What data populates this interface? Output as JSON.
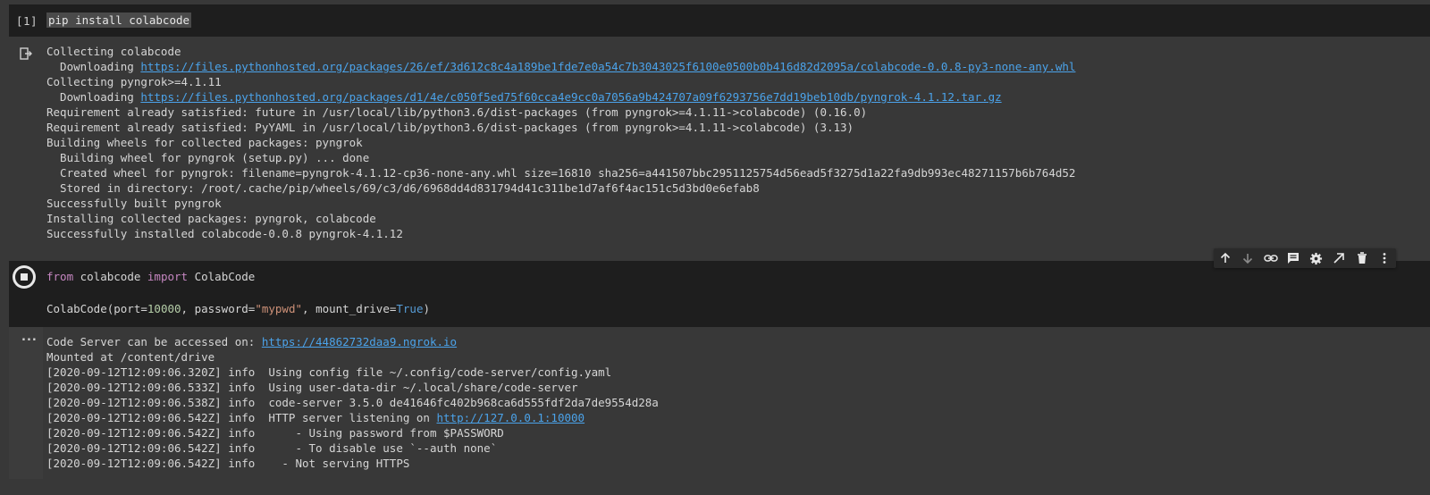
{
  "cell1": {
    "exec_count": "[1]",
    "code": "pip install colabcode",
    "output": {
      "line1": "Collecting colabcode",
      "line2_prefix": "  Downloading ",
      "line2_link": "https://files.pythonhosted.org/packages/26/ef/3d612c8c4a189be1fde7e0a54c7b3043025f6100e0500b0b416d82d2095a/colabcode-0.0.8-py3-none-any.whl",
      "line3": "Collecting pyngrok>=4.1.11",
      "line4_prefix": "  Downloading ",
      "line4_link": "https://files.pythonhosted.org/packages/d1/4e/c050f5ed75f60cca4e9cc0a7056a9b424707a09f6293756e7dd19beb10db/pyngrok-4.1.12.tar.gz",
      "line5": "Requirement already satisfied: future in /usr/local/lib/python3.6/dist-packages (from pyngrok>=4.1.11->colabcode) (0.16.0)",
      "line6": "Requirement already satisfied: PyYAML in /usr/local/lib/python3.6/dist-packages (from pyngrok>=4.1.11->colabcode) (3.13)",
      "line7": "Building wheels for collected packages: pyngrok",
      "line8": "  Building wheel for pyngrok (setup.py) ... done",
      "line9": "  Created wheel for pyngrok: filename=pyngrok-4.1.12-cp36-none-any.whl size=16810 sha256=a441507bbc2951125754d56ead5f3275d1a22fa9db993ec48271157b6b764d52",
      "line10": "  Stored in directory: /root/.cache/pip/wheels/69/c3/d6/6968dd4d831794d41c311be1d7af6f4ac151c5d3bd0e6efab8",
      "line11": "Successfully built pyngrok",
      "line12": "Installing collected packages: pyngrok, colabcode",
      "line13": "Successfully installed colabcode-0.0.8 pyngrok-4.1.12"
    }
  },
  "cell2": {
    "code_line1": {
      "kw_from": "from",
      "module": " colabcode ",
      "kw_import": "import",
      "name": " ColabCode"
    },
    "code_line2": {
      "p1": "ColabCode(port=",
      "port": "10000",
      "p2": ", password=",
      "password": "\"mypwd\"",
      "p3": ", mount_drive=",
      "mount": "True",
      "p4": ")"
    },
    "output": {
      "line1_prefix": "Code Server can be accessed on: ",
      "line1_link": "https://44862732daa9.ngrok.io",
      "line2": "Mounted at /content/drive",
      "line3": "[2020-09-12T12:09:06.320Z] info  Using config file ~/.config/code-server/config.yaml",
      "line4": "[2020-09-12T12:09:06.533Z] info  Using user-data-dir ~/.local/share/code-server",
      "line5": "[2020-09-12T12:09:06.538Z] info  code-server 3.5.0 de41646fc402b968ca6d555fdf2da7de9554d28a",
      "line6_prefix": "[2020-09-12T12:09:06.542Z] info  HTTP server listening on ",
      "line6_link": "http://127.0.0.1:10000",
      "line7": "[2020-09-12T12:09:06.542Z] info      - Using password from $PASSWORD",
      "line8": "[2020-09-12T12:09:06.542Z] info      - To disable use `--auth none`",
      "line9": "[2020-09-12T12:09:06.542Z] info    - Not serving HTTPS"
    },
    "ellipsis": "..."
  },
  "toolbar": {
    "icons": [
      "arrow-up-icon",
      "arrow-down-icon",
      "link-icon",
      "comment-icon",
      "gear-icon",
      "open-in-new-icon",
      "trash-icon",
      "more-vert-icon"
    ]
  }
}
